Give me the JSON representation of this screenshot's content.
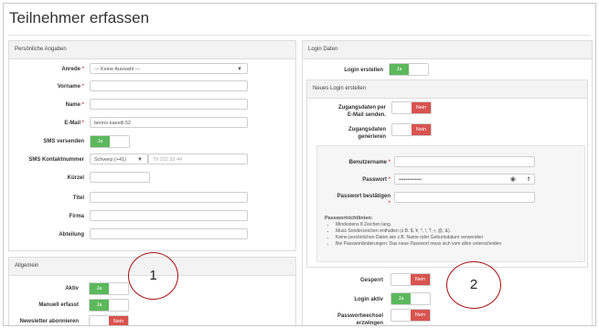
{
  "page": {
    "title": "Teilnehmer erfassen"
  },
  "personal": {
    "header": "Persönliche Angaben",
    "anrede": {
      "label": "Anrede",
      "value": "--- Keine Auswahl ---"
    },
    "vorname": {
      "label": "Vorname"
    },
    "name": {
      "label": "Name"
    },
    "email": {
      "label": "E-Mail",
      "value": "benno.kaestli.52"
    },
    "sms_send": {
      "label": "SMS versenden",
      "toggle": "Ja"
    },
    "sms_number": {
      "label": "SMS Kontaktnummer",
      "country": "Schweiz (+41)",
      "placeholder": "79 222 33 44"
    },
    "kuerzel": {
      "label": "Kürzel"
    },
    "titel": {
      "label": "Titel"
    },
    "firma": {
      "label": "Firma"
    },
    "abteilung": {
      "label": "Abteilung"
    }
  },
  "general": {
    "header": "Allgemein",
    "aktiv": {
      "label": "Aktiv",
      "toggle": "Ja"
    },
    "manuell": {
      "label": "Manuell erfasst",
      "toggle": "Ja"
    },
    "newsletter": {
      "label": "Newsletter abonnieren",
      "toggle": "Nein"
    }
  },
  "login": {
    "header": "Login Daten",
    "create": {
      "label": "Login erstellen",
      "toggle": "Ja"
    },
    "new_login_header": "Neues Login erstellen",
    "send_data": {
      "label": "Zugangsdaten per E-Mail senden.",
      "toggle": "Nein"
    },
    "generate": {
      "label": "Zugangsdaten generieren",
      "toggle": "Nein"
    },
    "username": {
      "label": "Benutzername"
    },
    "password": {
      "label": "Passwort",
      "value": "•••••••••••••",
      "show_icon": "eye-icon",
      "strength_icon": "info-icon"
    },
    "password_confirm": {
      "label": "Passwort bestätigen"
    },
    "rules": {
      "title": "Passwortrichtlinien:",
      "items": [
        "Mindestens 8 Zeichen lang.",
        "Muss Sonderzeichen enthalten (z.B. $, ¥, *, !, ?, •, @, &).",
        "Keine persönlichen Daten wie z.B. Name oder Geburtsdatum verwenden",
        "Bei Passwortänderungen: Das neue Passwort muss sich vom allen unterscheiden"
      ]
    },
    "gesperrt": {
      "label": "Gesperrt",
      "toggle": "Nein"
    },
    "login_aktiv": {
      "label": "Login aktiv",
      "toggle": "Ja"
    },
    "pw_change": {
      "label": "Passwortwechsel erzwingen",
      "toggle": "Nein"
    }
  },
  "annotations": {
    "one": "1",
    "two": "2"
  },
  "colors": {
    "green": "#5cb85c",
    "red": "#d9534f",
    "circle": "#a30f0f"
  }
}
